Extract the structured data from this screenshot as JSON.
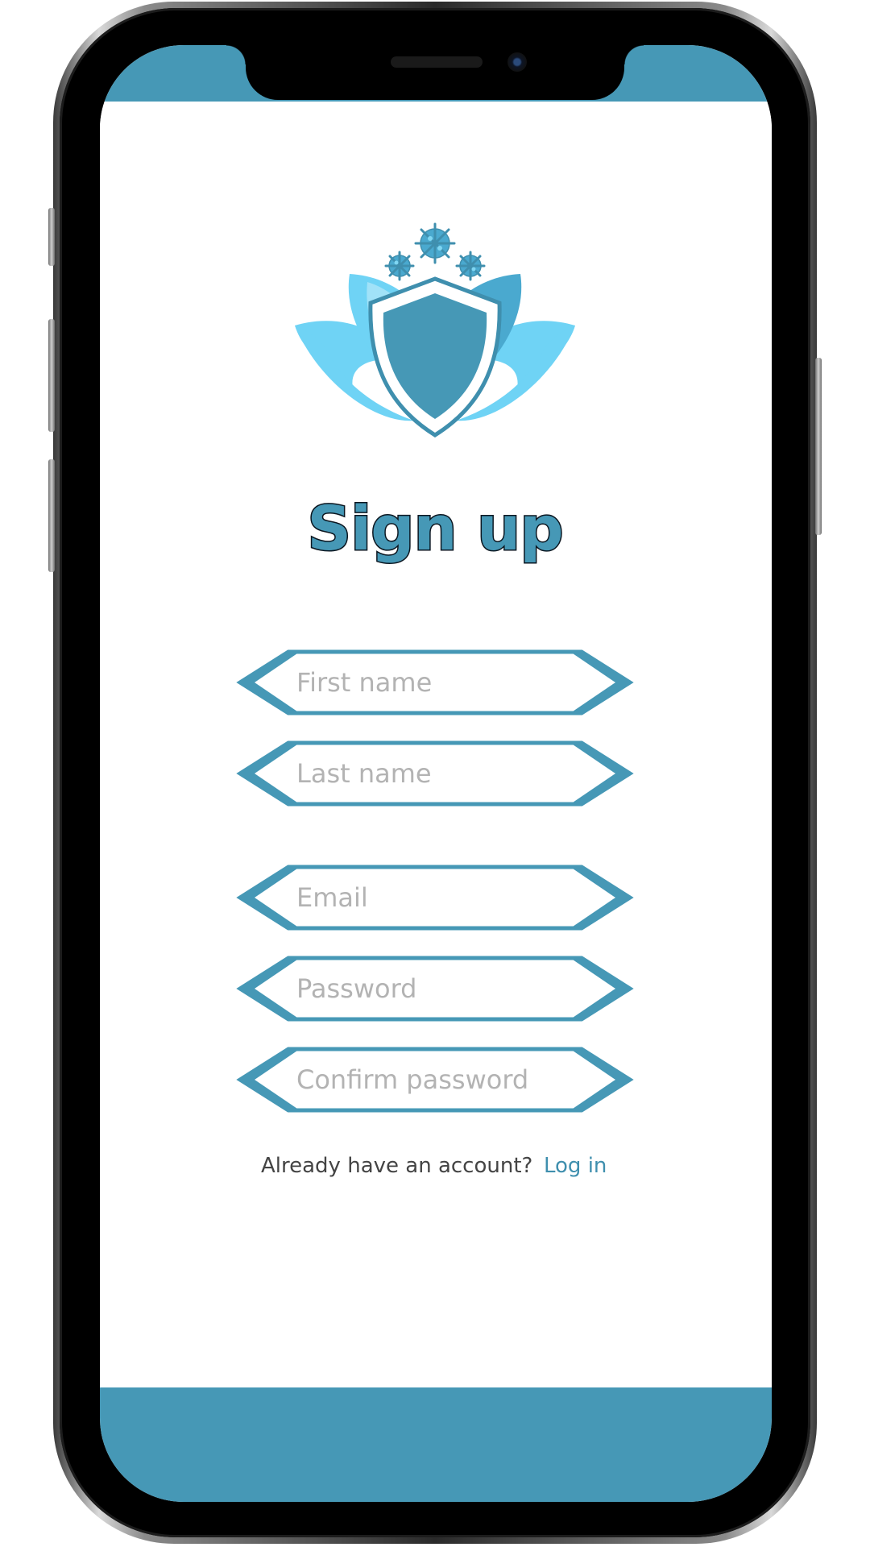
{
  "colors": {
    "accent": "#4698b6",
    "logo_light": "#6fd3f5",
    "placeholder": "#b3b3b3",
    "link": "#3f8fae"
  },
  "page": {
    "title": "Sign up"
  },
  "form": {
    "first_name_placeholder": "First name",
    "last_name_placeholder": "Last name",
    "email_placeholder": "Email",
    "password_placeholder": "Password",
    "confirm_password_placeholder": "Confirm password"
  },
  "footer": {
    "prompt": "Already have an account?",
    "login_label": "Log in"
  },
  "icons": {
    "logo": "lotus-shield-logo-icon"
  }
}
